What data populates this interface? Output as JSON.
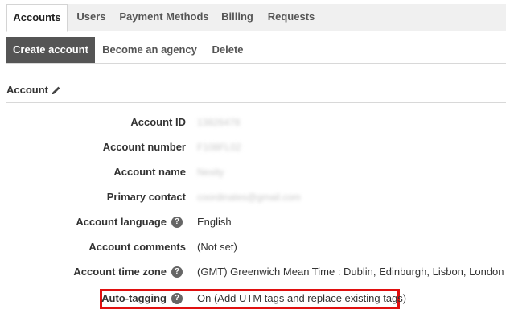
{
  "tabs": [
    {
      "label": "Accounts",
      "active": true
    },
    {
      "label": "Users",
      "active": false
    },
    {
      "label": "Payment Methods",
      "active": false
    },
    {
      "label": "Billing",
      "active": false
    },
    {
      "label": "Requests",
      "active": false
    }
  ],
  "actions": {
    "create_account": "Create account",
    "become_agency": "Become an agency",
    "delete": "Delete"
  },
  "section": {
    "title": "Account"
  },
  "help_glyph": "?",
  "fields": {
    "account_id": {
      "label": "Account ID",
      "value": "13826478"
    },
    "account_number": {
      "label": "Account number",
      "value": "F108FL02"
    },
    "account_name": {
      "label": "Account name",
      "value": "Nexity"
    },
    "primary_contact": {
      "label": "Primary contact",
      "value": "coordinates@gmail.com"
    },
    "account_language": {
      "label": "Account language",
      "value": "English"
    },
    "account_comments": {
      "label": "Account comments",
      "value": "(Not set)"
    },
    "account_time_zone": {
      "label": "Account time zone",
      "value": "(GMT) Greenwich Mean Time : Dublin, Edinburgh, Lisbon, London"
    },
    "auto_tagging": {
      "label": "Auto-tagging",
      "value": "On (Add UTM tags and replace existing tags)"
    }
  },
  "colors": {
    "highlight": "#e01010",
    "primary_button": "#555555"
  }
}
